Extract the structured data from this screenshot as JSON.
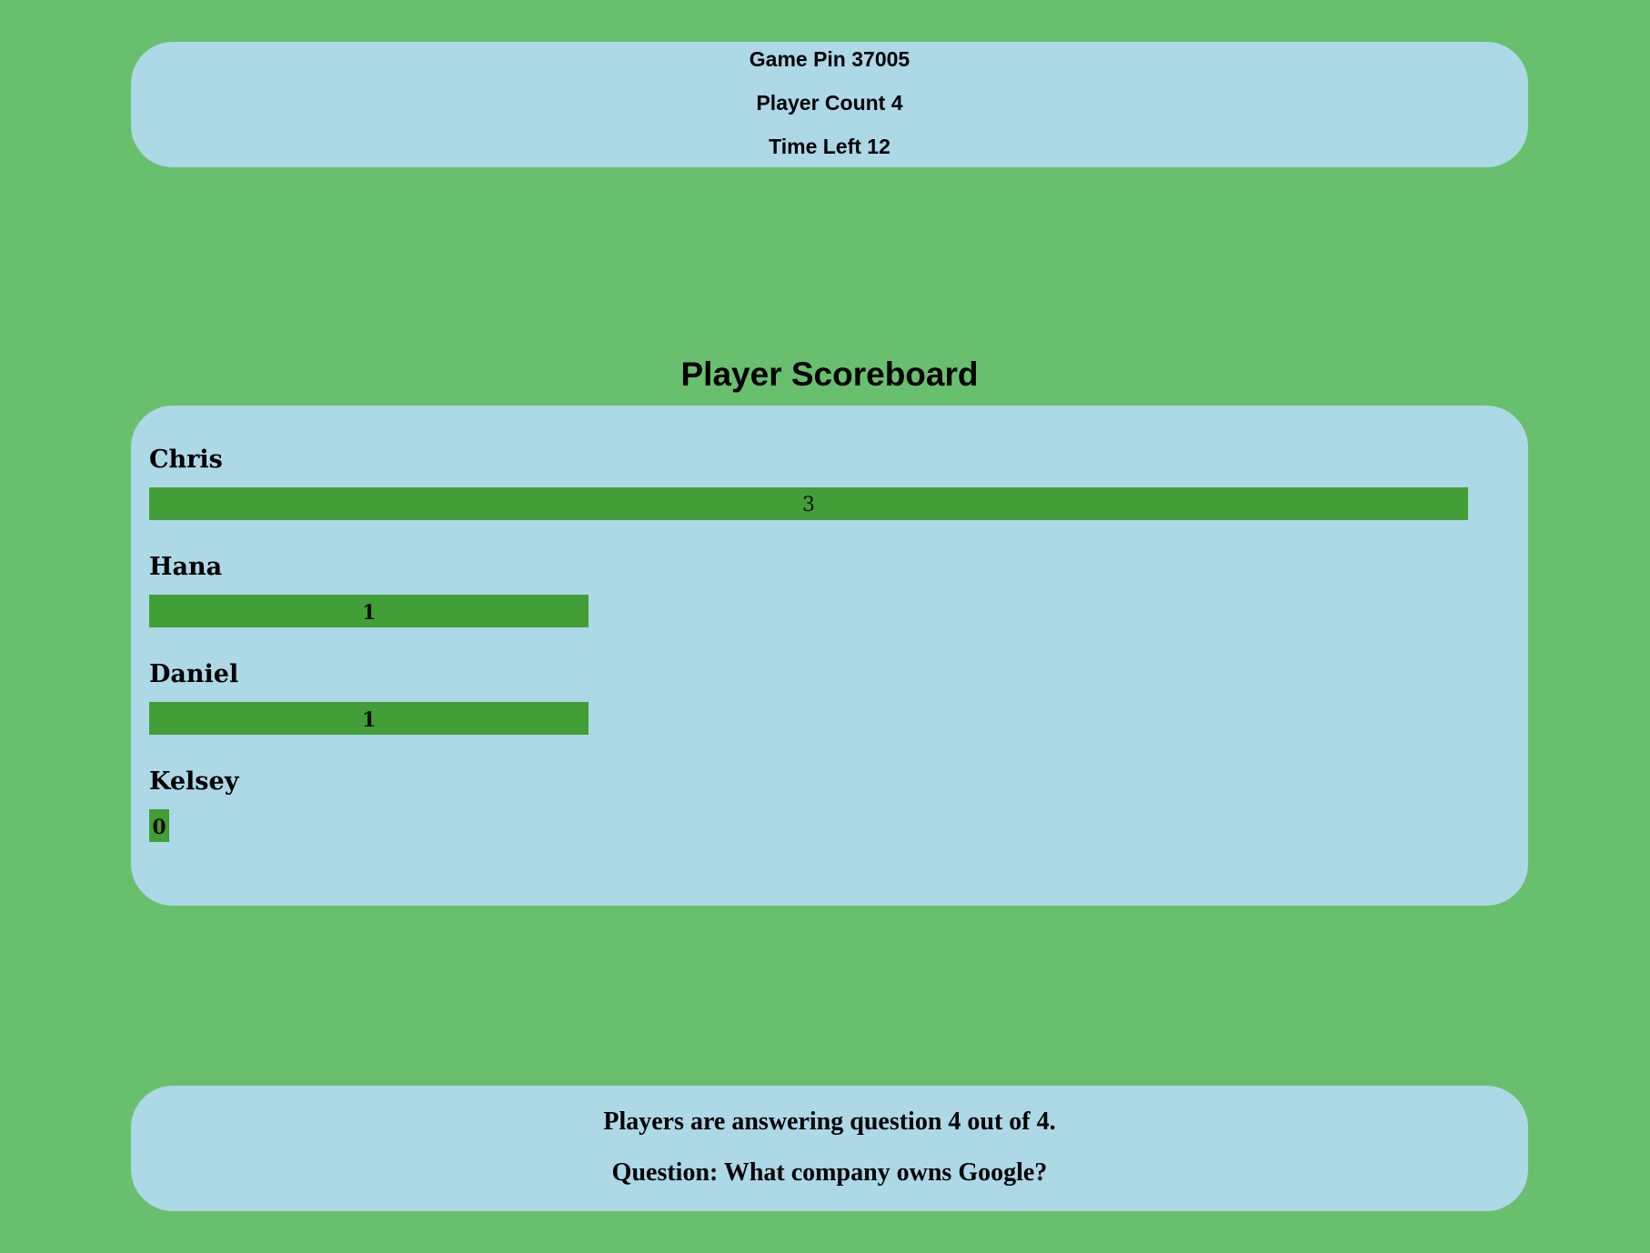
{
  "header": {
    "game_pin": "Game Pin 37005",
    "player_count": "Player Count 4",
    "time_left": "Time Left 12"
  },
  "scoreboard": {
    "title": "Player Scoreboard",
    "max_score": 3,
    "players": [
      {
        "name": "Chris",
        "score": 3,
        "score_label": "3"
      },
      {
        "name": "Hana",
        "score": 1,
        "score_label": "1"
      },
      {
        "name": "Daniel",
        "score": 1,
        "score_label": "1"
      },
      {
        "name": "Kelsey",
        "score": 0,
        "score_label": "0"
      }
    ]
  },
  "status": {
    "progress_text": "Players are answering question 4 out of 4.",
    "question_text": "Question: What company owns Google?"
  },
  "colors": {
    "background": "#68c06e",
    "panel": "#add8e6",
    "bar": "#429e37"
  }
}
